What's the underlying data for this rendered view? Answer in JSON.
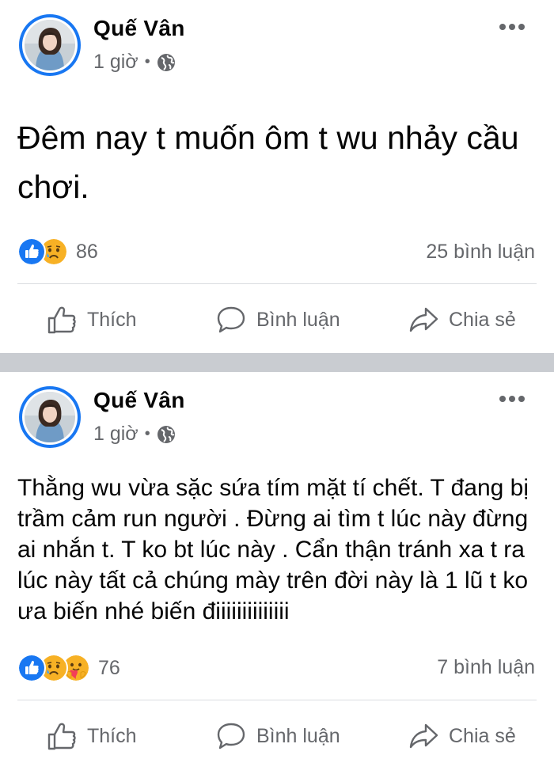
{
  "posts": [
    {
      "author": "Quế Vân",
      "time": "1 giờ",
      "separator": "•",
      "privacy_icon": "globe-icon",
      "text": "Đêm nay t muốn ôm t wu nhảy cầu chơi.",
      "reactions": [
        "like-icon",
        "sad-icon"
      ],
      "reaction_count": "86",
      "comment_count": "25 bình luận"
    },
    {
      "author": "Quế Vân",
      "time": "1 giờ",
      "separator": "•",
      "privacy_icon": "globe-icon",
      "text": "Thằng wu vừa sặc sứa tím mặt tí chết. T đang bị trầm cảm run người . Đừng ai tìm t lúc này đừng ai nhắn t. T ko bt lúc này . Cẩn thận tránh xa t ra lúc này tất cả chúng mày trên đời này là 1 lũ t ko ưa  biến nhé biến điiiiiiiiiiiiii",
      "reactions": [
        "like-icon",
        "sad-icon",
        "care-icon"
      ],
      "reaction_count": "76",
      "comment_count": "7 bình luận"
    }
  ],
  "actions": {
    "like": "Thích",
    "comment": "Bình luận",
    "share": "Chia sẻ"
  },
  "colors": {
    "brand_blue": "#1877f2",
    "secondary_text": "#65676b",
    "separator": "#c9ccd1",
    "sad_yellow": "#f7b125"
  }
}
